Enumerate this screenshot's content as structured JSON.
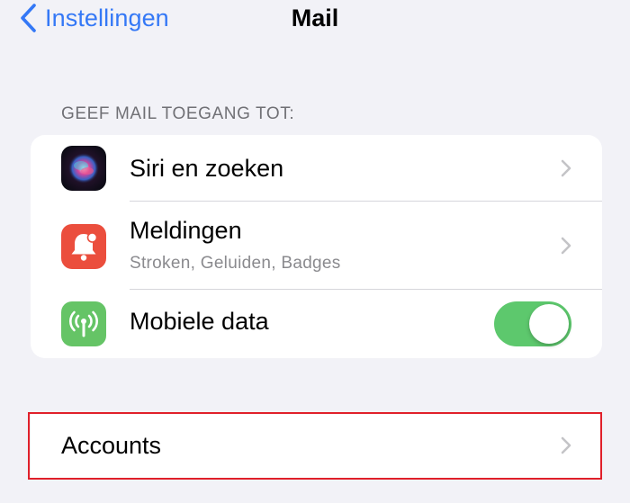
{
  "nav": {
    "back_label": "Instellingen",
    "title": "Mail"
  },
  "section": {
    "header": "GEEF MAIL TOEGANG TOT:"
  },
  "rows": [
    {
      "title": "Siri en zoeken",
      "icon": "siri-icon",
      "accessory": "chevron"
    },
    {
      "title": "Meldingen",
      "subtitle": "Stroken, Geluiden, Badges",
      "icon": "notifications-bell-icon",
      "accessory": "chevron"
    },
    {
      "title": "Mobiele data",
      "icon": "cellular-antenna-icon",
      "accessory": "toggle",
      "toggle_on": true
    }
  ],
  "accounts": {
    "label": "Accounts",
    "highlighted": true
  },
  "colors": {
    "background": "#F2F2F7",
    "accent": "#3478F6",
    "toggle_on": "#5DC86D",
    "notifications_icon": "#EB4E3D",
    "cellular_icon": "#65C466",
    "highlight_border": "#E0202A"
  }
}
